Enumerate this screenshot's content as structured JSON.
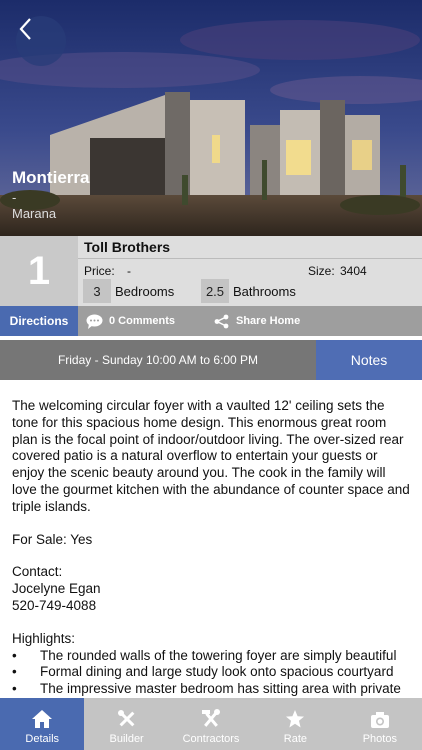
{
  "home": {
    "name": "Montierra",
    "dash": "-",
    "city": "Marana"
  },
  "info": {
    "rank": "1",
    "builder": "Toll Brothers",
    "price_label": "Price:",
    "price_value": "-",
    "size_label": "Size:",
    "size_value": "3404",
    "bedrooms_value": "3",
    "bedrooms_label": "Bedrooms",
    "bathrooms_value": "2.5",
    "bathrooms_label": "Bathrooms"
  },
  "actions": {
    "directions": "Directions",
    "comments": "0 Comments",
    "share": "Share Home"
  },
  "hours": "Friday - Sunday 10:00 AM to 6:00 PM",
  "notes": "Notes",
  "description": "The welcoming circular foyer with a vaulted 12' ceiling sets the tone for this spacious home design. This enormous great room plan is the focal point of indoor/outdoor living. The over-sized rear covered patio is a natural overflow to entertain your guests or enjoy the scenic beauty around you. The cook in the family will love the gourmet kitchen with the abundance of counter space and triple islands.",
  "for_sale": "For Sale: Yes",
  "contact": {
    "heading": "Contact:",
    "name": "Jocelyne Egan",
    "phone": "520-749-4088"
  },
  "highlights": {
    "heading": "Highlights:",
    "items": [
      "The rounded walls of the towering foyer are simply beautiful",
      "Formal dining and large study look onto spacious courtyard",
      "The impressive master bedroom has sitting area with private"
    ]
  },
  "tabs": [
    {
      "label": "Details",
      "icon": "house-icon"
    },
    {
      "label": "Builder",
      "icon": "tools-icon"
    },
    {
      "label": "Contractors",
      "icon": "hammer-wrench-icon"
    },
    {
      "label": "Rate",
      "icon": "star-icon"
    },
    {
      "label": "Photos",
      "icon": "camera-icon"
    }
  ],
  "colors": {
    "accent": "#4a6ab0",
    "tabbar": "#c4c4c4",
    "hours_bg": "#767676"
  }
}
